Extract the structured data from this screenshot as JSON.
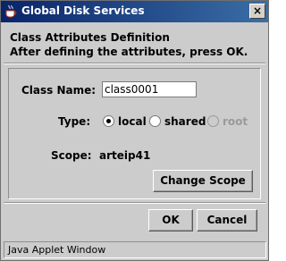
{
  "window": {
    "title": "Global Disk Services"
  },
  "header": {
    "line1": "Class Attributes Definition",
    "line2": "After defining the attributes, press OK."
  },
  "form": {
    "class_name_label": "Class Name:",
    "class_name_value": "class0001",
    "type_label": "Type:",
    "type_options": [
      {
        "label": "local",
        "selected": true,
        "enabled": true
      },
      {
        "label": "shared",
        "selected": false,
        "enabled": true
      },
      {
        "label": "root",
        "selected": false,
        "enabled": false
      }
    ],
    "scope_label": "Scope:",
    "scope_value": "arteip41",
    "change_scope_label": "Change Scope"
  },
  "buttons": {
    "ok_label": "OK",
    "cancel_label": "Cancel"
  },
  "status": {
    "text": "Java Applet Window"
  },
  "icons": {
    "title": "java-cup-icon",
    "close": "close-icon"
  }
}
